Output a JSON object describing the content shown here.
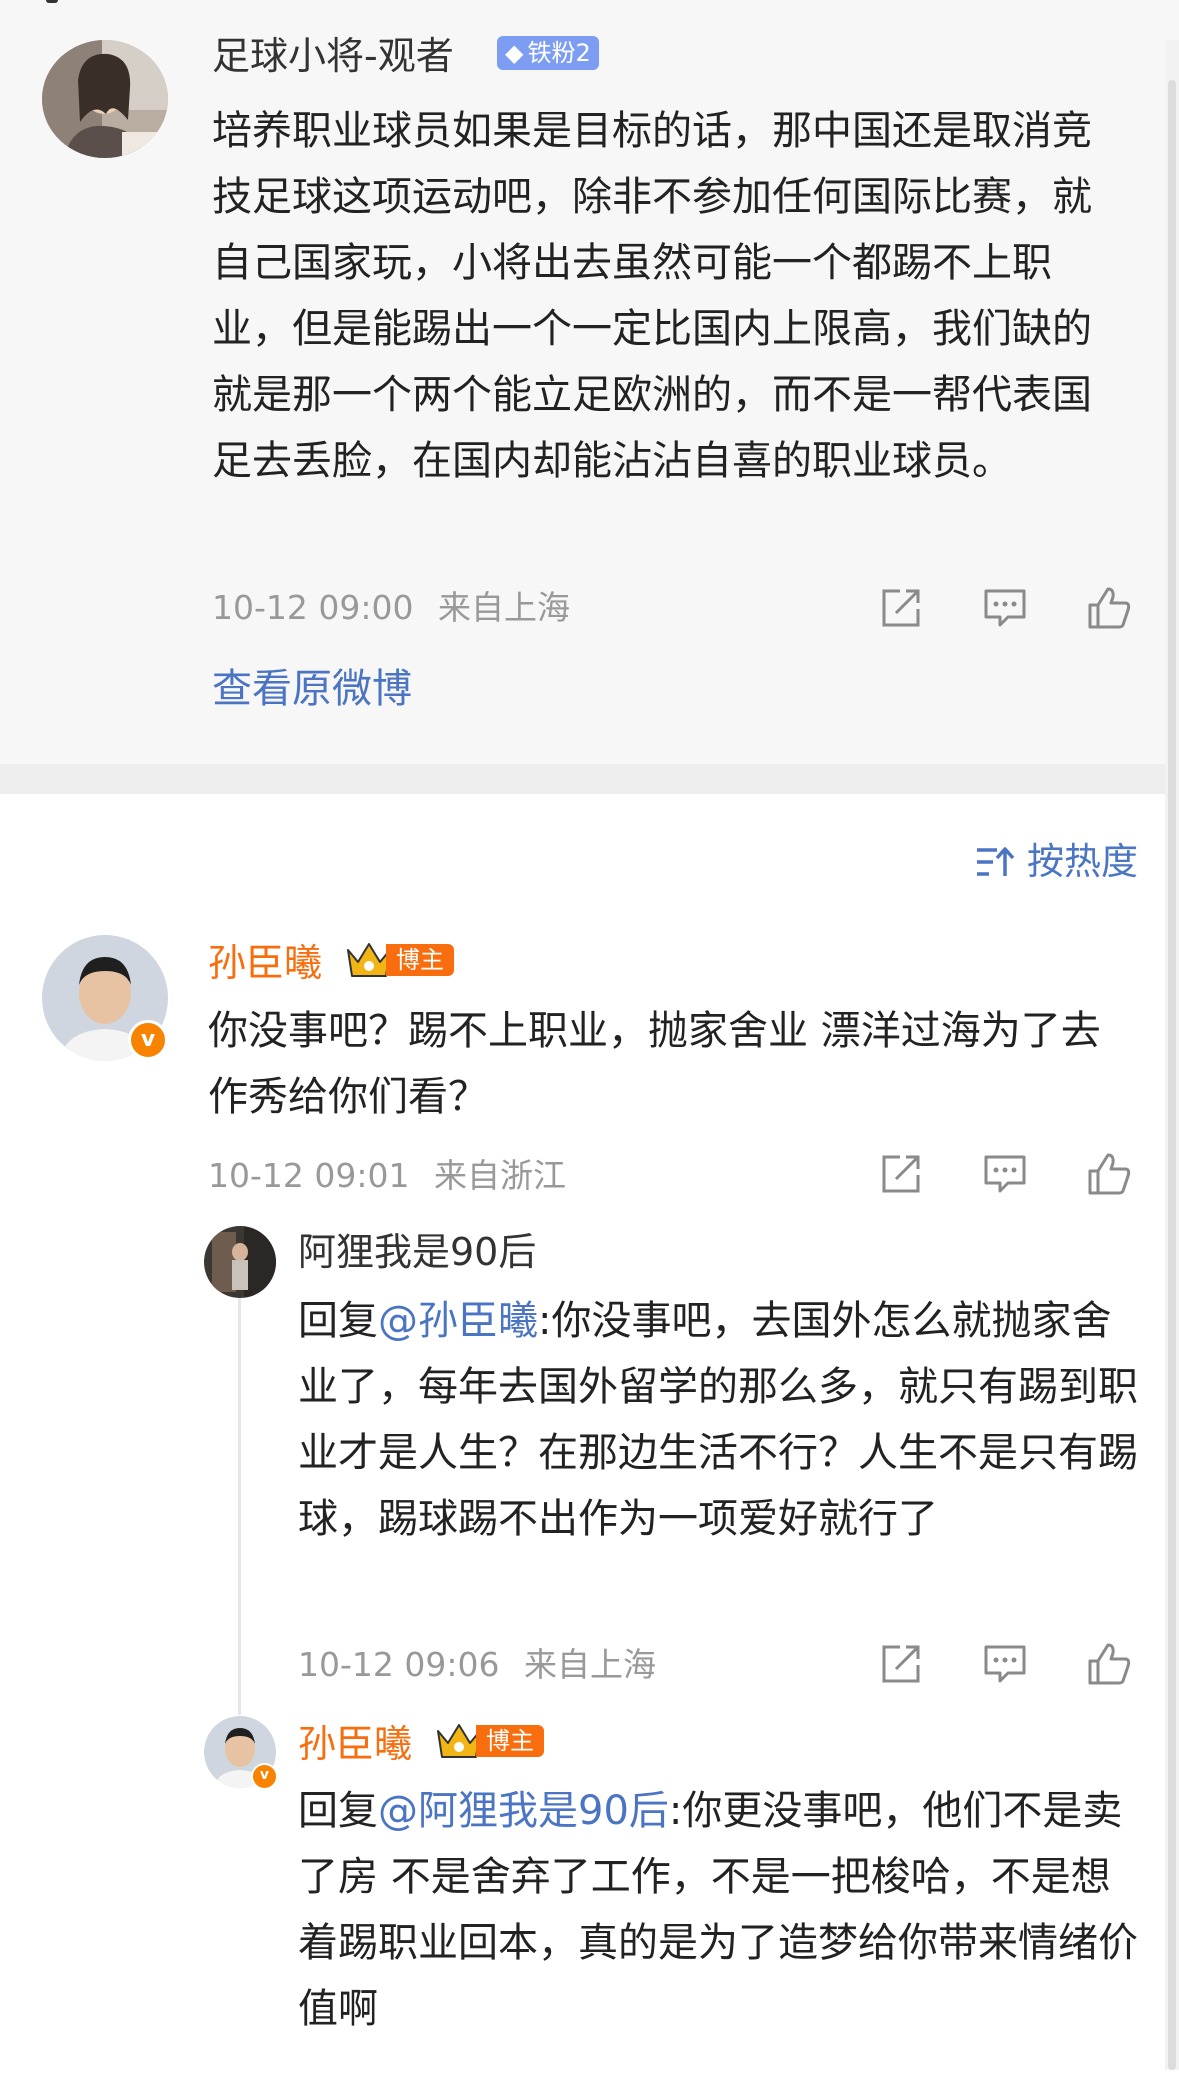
{
  "post": {
    "author": "足球小将-观者",
    "fan_badge": "铁粉2",
    "text": "培养职业球员如果是目标的话，那中国还是取消竞技足球这项运动吧，除非不参加任何国际比赛，就自己国家玩，小将出去虽然可能一个都踢不上职业，但是能踢出一个一定比国内上限高，我们缺的就是那一个两个能立足欧洲的，而不是一帮代表国足去丢脸，在国内却能沾沾自喜的职业球员。",
    "time": "10-12 09:00",
    "source": "来自上海",
    "view_original": "查看原微博"
  },
  "sort": {
    "label": "按热度"
  },
  "comments": [
    {
      "author": "孙臣曦",
      "badge": "博主",
      "text": "你没事吧？踢不上职业，抛家舍业 漂洋过海为了去作秀给你们看？",
      "time": "10-12 09:01",
      "source": "来自浙江"
    }
  ],
  "replies": [
    {
      "author": "阿狸我是90后",
      "reply_prefix": "回复",
      "mention": "@孙臣曦",
      "text": ":你没事吧，去国外怎么就抛家舍业了，每年去国外留学的那么多，就只有踢到职业才是人生？在那边生活不行？人生不是只有踢球，踢球踢不出作为一项爱好就行了",
      "time": "10-12 09:06",
      "source": "来自上海"
    },
    {
      "author": "孙臣曦",
      "badge": "博主",
      "reply_prefix": "回复",
      "mention": "@阿狸我是90后",
      "text": ":你更没事吧，他们不是卖了房 不是舍弃了工作，不是一把梭哈，不是想着踢职业回本，真的是为了造梦给你带来情绪价值啊"
    }
  ],
  "icons": {
    "share": "share-icon",
    "comment": "comment-icon",
    "like": "like-icon",
    "sort": "sort-icon",
    "verified": "verified-v-icon",
    "crown": "crown-icon",
    "diamond": "diamond-icon"
  },
  "colors": {
    "link_blue": "#4b74c2",
    "vip_orange": "#f86e0e",
    "verify_orange": "#f78300",
    "fan_badge_blue": "#7d9df2",
    "meta_gray": "#999999"
  }
}
